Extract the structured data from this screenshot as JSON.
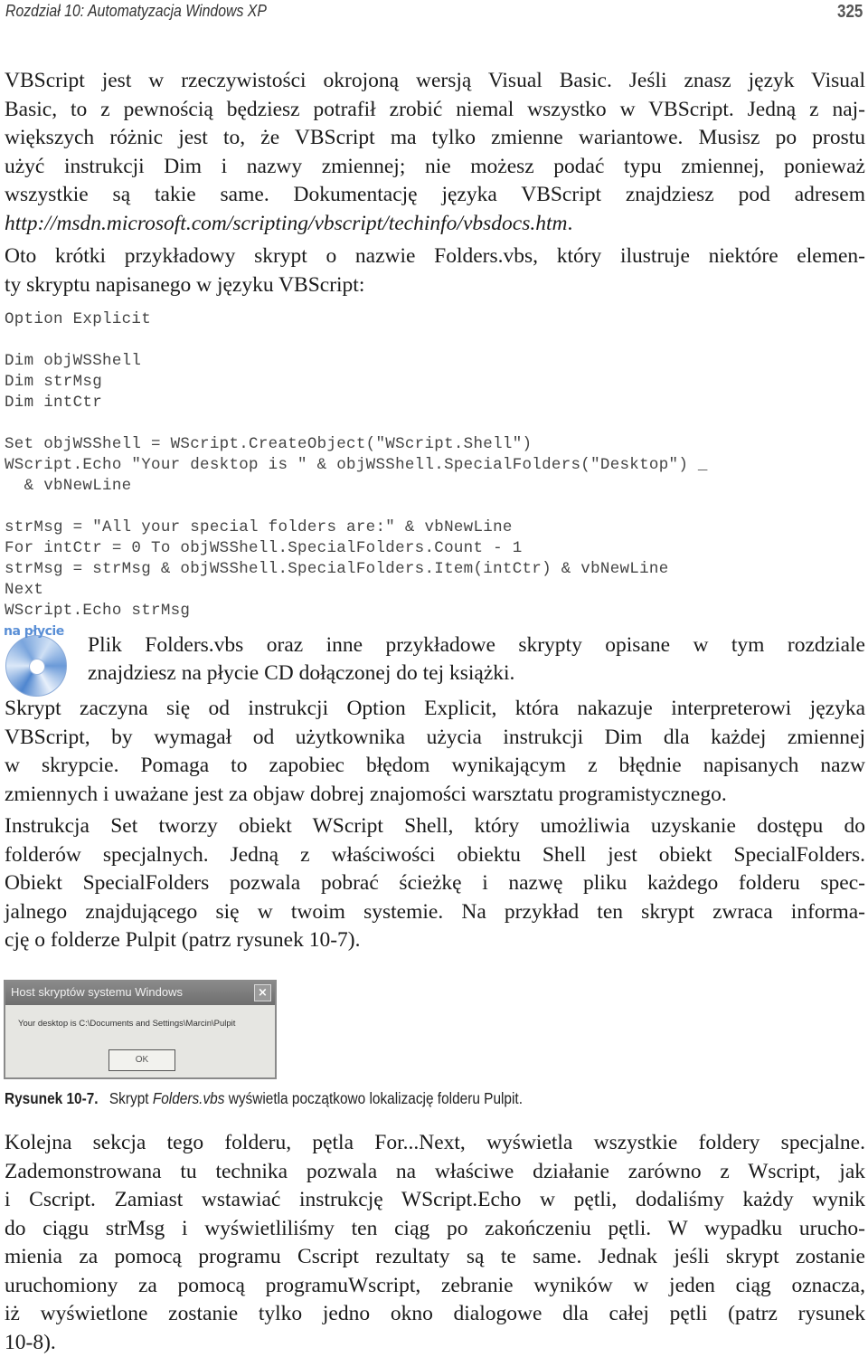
{
  "header": {
    "chapter_title": "Rozdział 10: Automatyzacja Windows XP",
    "page_number": "325"
  },
  "paragraphs": {
    "p1": [
      "VBScript jest w rzeczywistości okrojoną wersją Visual Basic. Jeśli znasz język Visual",
      "Basic, to z pewnością będziesz potrafił zrobić niemal wszystko w VBScript. Jedną z naj-",
      "większych różnic jest to, że VBScript ma tylko zmienne wariantowe. Musisz po prostu",
      "użyć instrukcji Dim i nazwy zmiennej; nie możesz podać typu zmiennej, ponieważ",
      "wszystkie są takie same. Dokumentację języka VBScript znajdziesz pod adresem"
    ],
    "p1_url": "http://msdn.microsoft.com/scripting/vbscript/techinfo/vbsdocs.htm",
    "p1_url_suffix": ".",
    "p2": [
      "Oto krótki przykładowy skrypt o nazwie Folders.vbs, który ilustruje niektóre elemen-",
      "ty skryptu napisanego w języku VBScript:"
    ],
    "p3": [
      "Skrypt zaczyna się od instrukcji Option Explicit, która nakazuje interpreterowi języka",
      "VBScript, by wymagał od użytkownika użycia instrukcji Dim dla każdej zmiennej",
      "w skrypcie. Pomaga to zapobiec błędom wynikającym z błędnie napisanych nazw",
      "zmiennych i uważane jest za objaw dobrej znajomości warsztatu programistycznego."
    ],
    "p4": [
      "Instrukcja Set tworzy obiekt WScript Shell, który umożliwia uzyskanie dostępu do",
      "folderów specjalnych. Jedną z właściwości obiektu Shell jest obiekt SpecialFolders.",
      "Obiekt SpecialFolders pozwala pobrać ścieżkę i nazwę pliku każdego folderu spec-",
      "jalnego znajdującego się w twoim systemie. Na przykład ten skrypt zwraca informa-",
      "cję o folderze Pulpit (patrz rysunek 10-7)."
    ],
    "p5": [
      "Kolejna sekcja tego folderu, pętla For...Next, wyświetla wszystkie foldery specjalne.",
      "Zademonstrowana tu technika pozwala na właściwe działanie zarówno z Wscript, jak",
      "i Cscript. Zamiast wstawiać instrukcję WScript.Echo w pętli, dodaliśmy każdy wynik",
      "do ciągu strMsg i wyświetliliśmy ten ciąg po zakończeniu pętli. W wypadku urucho-",
      "mienia za pomocą programu Cscript rezultaty są te same. Jednak jeśli skrypt zostanie",
      "uruchomiony za pomocą programuWscript, zebranie wyników w jeden ciąg oznacza,",
      "iż wyświetlone zostanie tylko jedno okno dialogowe dla całej pętli (patrz rysunek",
      "10-8)."
    ]
  },
  "code_listing": [
    "Option Explicit",
    "",
    "Dim objWSShell",
    "Dim strMsg",
    "Dim intCtr",
    "",
    "Set objWSShell = WScript.CreateObject(\"WScript.Shell\")",
    "WScript.Echo \"Your desktop is \" & objWSShell.SpecialFolders(\"Desktop\") _",
    "  & vbNewLine",
    "",
    "strMsg = \"All your special folders are:\" & vbNewLine",
    "For intCtr = 0 To objWSShell.SpecialFolders.Count - 1",
    "strMsg = strMsg & objWSShell.SpecialFolders.Item(intCtr) & vbNewLine",
    "Next",
    "WScript.Echo strMsg"
  ],
  "cd_note": {
    "label": "na płycie",
    "icon": "cd-disc-icon",
    "lines": [
      "Plik Folders.vbs oraz inne przykładowe skrypty opisane w tym rozdziale",
      "znajdziesz na płycie CD dołączonej do tej książki."
    ]
  },
  "figure": {
    "dialog": {
      "title": "Host skryptów systemu Windows",
      "close_icon": "×",
      "message": "Your desktop is C:\\Documents and Settings\\Marcin\\Pulpit",
      "ok_label": "OK"
    },
    "caption_label": "Rysunek 10-7.",
    "caption_prefix": "Skrypt ",
    "caption_italic": "Folders.vbs",
    "caption_suffix": " wyświetla początkowo lokalizację folderu Pulpit."
  }
}
